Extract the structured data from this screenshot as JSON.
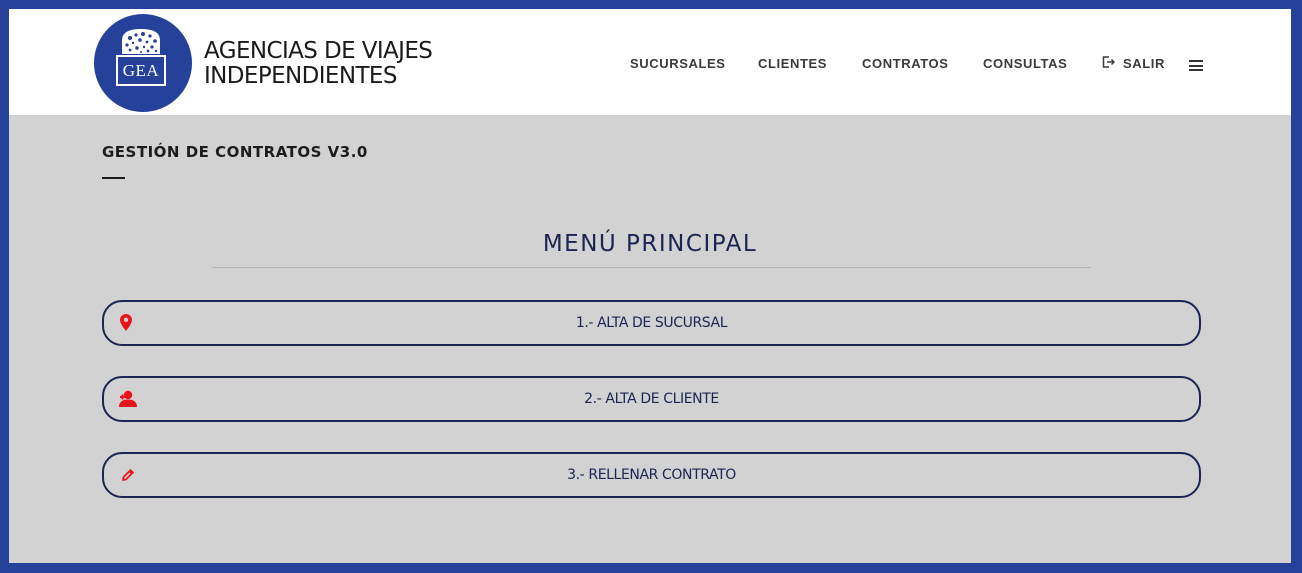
{
  "brand": {
    "logo_text": "GEA",
    "name_line1": "AGENCIAS DE VIAJES",
    "name_line2": "INDEPENDIENTES",
    "color": "#26419a"
  },
  "nav": {
    "items": [
      {
        "label": "SUCURSALES"
      },
      {
        "label": "CLIENTES"
      },
      {
        "label": "CONTRATOS"
      },
      {
        "label": "CONSULTAS"
      }
    ],
    "logout": {
      "label": "SALIR",
      "icon": "logout-icon"
    },
    "menu_icon": "hamburger-menu-icon"
  },
  "page": {
    "title": "GESTIÓN DE CONTRATOS V3.0",
    "menu_heading": "MENÚ PRINCIPAL"
  },
  "menu": [
    {
      "label": "1.- ALTA DE SUCURSAL",
      "icon": "map-pin-icon"
    },
    {
      "label": "2.- ALTA DE CLIENTE",
      "icon": "add-user-icon"
    },
    {
      "label": "3.- RELLENAR CONTRATO",
      "icon": "pencil-icon"
    }
  ],
  "colors": {
    "frame": "#26419a",
    "background": "#d2d2d2",
    "header": "#ffffff",
    "button_border": "#1b2452",
    "icon_accent": "#e8141c"
  }
}
